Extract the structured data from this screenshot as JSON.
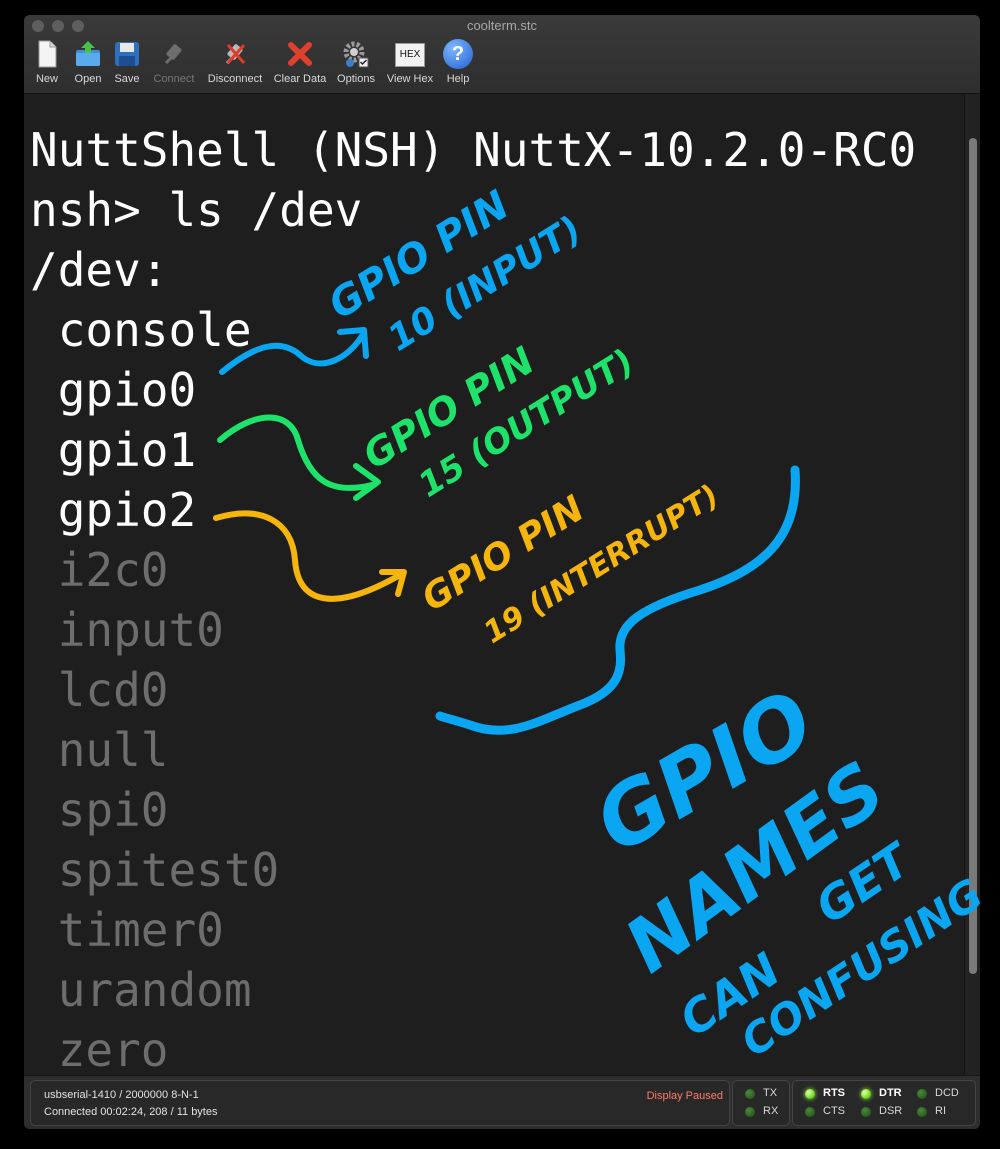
{
  "window": {
    "title": "coolterm.stc"
  },
  "toolbar": {
    "new": "New",
    "open": "Open",
    "save": "Save",
    "connect": "Connect",
    "disconnect": "Disconnect",
    "clear_data": "Clear Data",
    "options": "Options",
    "view_hex": "View Hex",
    "hex_badge": "HEX",
    "help": "Help",
    "help_glyph": "?"
  },
  "terminal": {
    "line1": "NuttShell (NSH) NuttX-10.2.0-RC0",
    "line2": "nsh> ls /dev",
    "line3": "/dev:",
    "devices": [
      " console",
      " gpio0",
      " gpio1",
      " gpio2",
      " i2c0",
      " input0",
      " lcd0",
      " null",
      " spi0",
      " spitest0",
      " timer0",
      " urandom",
      " zero"
    ]
  },
  "annotations": {
    "gpio0_a": "GPIO PIN",
    "gpio0_b": "10 (INPUT)",
    "gpio1_a": "GPIO PIN",
    "gpio1_b": "15 (OUTPUT)",
    "gpio2_a": "GPIO PIN",
    "gpio2_b": "19 (INTERRUPT)",
    "big1": "GPIO",
    "big2": "NAMES",
    "big3": "CAN",
    "big4": "GET",
    "big5": "CONFUSING",
    "colors": {
      "blue": "#0aa6f2",
      "green": "#1ee36a",
      "yellow": "#f6b50c"
    }
  },
  "status": {
    "port": "usbserial-1410 / 2000000 8-N-1",
    "connection": "Connected 00:02:24, 208 / 11 bytes",
    "paused": "Display Paused",
    "tx": "TX",
    "rx": "RX",
    "rts": "RTS",
    "cts": "CTS",
    "dtr": "DTR",
    "dsr": "DSR",
    "dcd": "DCD",
    "ri": "RI"
  }
}
